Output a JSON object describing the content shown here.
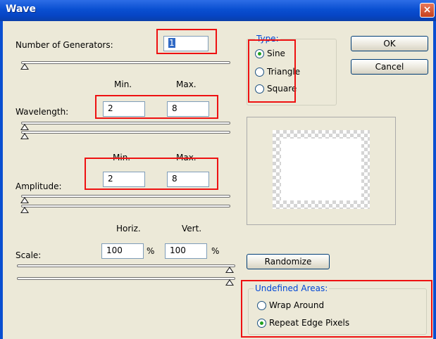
{
  "window": {
    "title": "Wave",
    "close_glyph": "×"
  },
  "generators": {
    "label": "Number of Generators:",
    "value": "1"
  },
  "wavelength": {
    "min_header": "Min.",
    "max_header": "Max.",
    "label": "Wavelength:",
    "min_value": "2",
    "max_value": "8"
  },
  "amplitude": {
    "min_header": "Min.",
    "max_header": "Max.",
    "label": "Amplitude:",
    "min_value": "2",
    "max_value": "8"
  },
  "scale": {
    "horiz_header": "Horiz.",
    "vert_header": "Vert.",
    "label": "Scale:",
    "horiz_value": "100",
    "vert_value": "100",
    "unit": "%"
  },
  "type_group": {
    "title": "Type:",
    "options": [
      {
        "label": "Sine",
        "selected": true
      },
      {
        "label": "Triangle",
        "selected": false
      },
      {
        "label": "Square",
        "selected": false
      }
    ]
  },
  "buttons": {
    "ok": "OK",
    "cancel": "Cancel",
    "randomize": "Randomize"
  },
  "undefined_areas": {
    "title": "Undefined Areas:",
    "options": [
      {
        "label": "Wrap Around",
        "selected": false
      },
      {
        "label": "Repeat Edge Pixels",
        "selected": true
      }
    ]
  },
  "colors": {
    "title_bar": "#0a4fd1",
    "highlight_box": "#ee1111",
    "group_title": "#0046d5"
  }
}
